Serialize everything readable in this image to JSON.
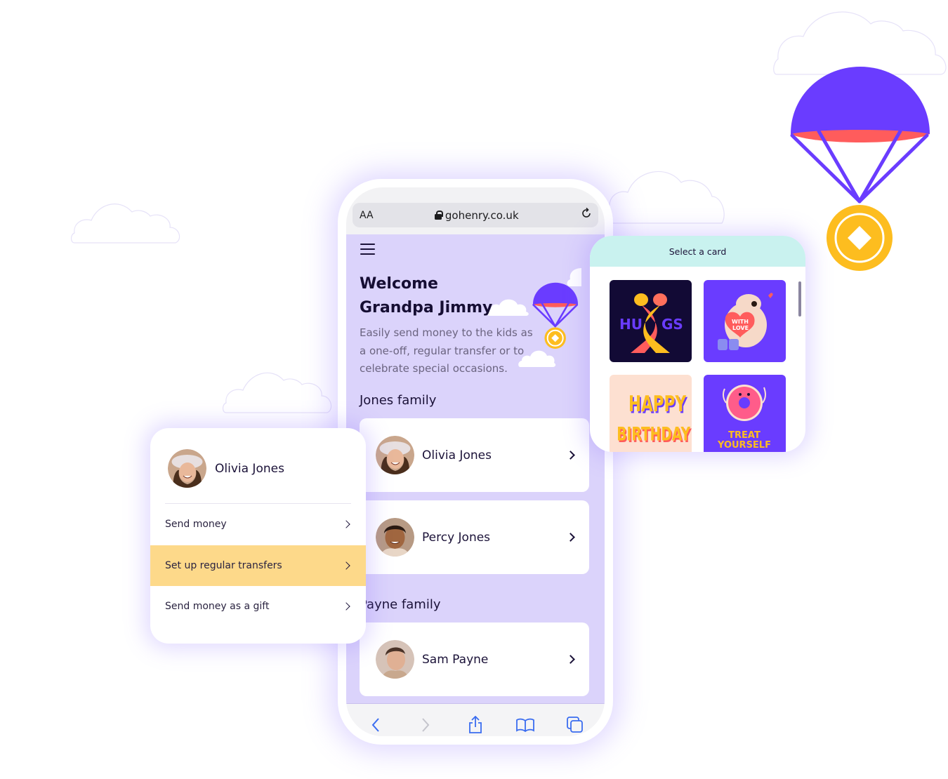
{
  "browser": {
    "text_size_label": "AA",
    "url": "gohenry.co.uk",
    "lock_icon": "lock-icon",
    "reload_icon": "reload-icon"
  },
  "page": {
    "menu_icon": "hamburger-icon",
    "welcome_line1": "Welcome",
    "welcome_line2": "Grandpa Jimmy",
    "intro": "Easily send money to the kids as a one-off, regular transfer or to celebrate special occasions.",
    "families": [
      {
        "name": "Jones family",
        "kids": [
          {
            "name": "Olivia Jones"
          },
          {
            "name": "Percy Jones"
          }
        ]
      },
      {
        "name": "Payne family",
        "kids": [
          {
            "name": "Sam Payne"
          }
        ]
      }
    ]
  },
  "toolbar": {
    "icons": [
      "back-icon",
      "forward-icon",
      "share-icon",
      "bookmarks-icon",
      "tabs-icon"
    ]
  },
  "card_selector": {
    "title": "Select a card",
    "cards": [
      {
        "label": "HUGS",
        "bg": "#120a35"
      },
      {
        "label": "WITH LOVE",
        "bg": "#6a3cff"
      },
      {
        "label": "HAPPY BIRTHDAY",
        "bg": "#fde0d1"
      },
      {
        "label": "TREAT YOURSELF",
        "bg": "#6a3cff"
      }
    ]
  },
  "action_panel": {
    "name": "Olivia Jones",
    "items": [
      {
        "label": "Send money",
        "active": false
      },
      {
        "label": "Set up regular transfers",
        "active": true
      },
      {
        "label": "Send money as a gift",
        "active": false
      }
    ]
  },
  "colors": {
    "brand_purple": "#6a3cff",
    "page_bg": "#dbd3fb",
    "coin_yellow": "#fdbd1f",
    "chute_red": "#ff5c5c",
    "highlight": "#fdd98a",
    "card_header": "#c9f2ef"
  }
}
